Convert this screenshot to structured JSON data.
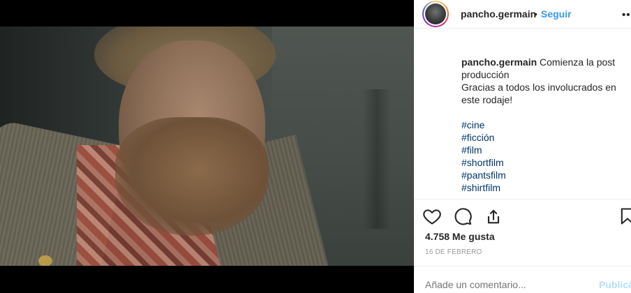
{
  "post": {
    "username": "pancho.germain",
    "separator": "•",
    "follow_label": "Seguir",
    "more_label": "••",
    "caption": {
      "username": "pancho.germain",
      "line1": "Comienza la post producción",
      "line2": "Gracias a todos los involucrados en este rodaje!",
      "hashtags": [
        "#cine",
        "#ficción",
        "#film",
        "#shortfilm",
        "#pantsfilm",
        "#shirtfilm"
      ]
    },
    "icons": [
      "heart-icon",
      "comment-icon",
      "share-icon",
      "bookmark-icon"
    ],
    "likes": "4.758 Me gusta",
    "date": "16 DE FEBRERO",
    "comment_placeholder": "Añade un comentario...",
    "publish_label": "Publica"
  },
  "colors": {
    "link": "#3897f0",
    "hashtag": "#003569",
    "muted": "#999999",
    "publish_disabled": "#b2dffc"
  }
}
